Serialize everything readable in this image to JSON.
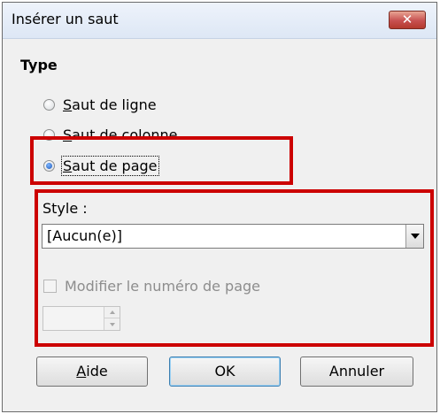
{
  "window": {
    "title": "Insérer un saut",
    "close_glyph": "✕"
  },
  "type_section": {
    "heading": "Type",
    "options": [
      {
        "label": "Saut de ligne",
        "selected": false
      },
      {
        "label": "Saut de colonne",
        "selected": false
      },
      {
        "label": "Saut de page",
        "selected": true
      }
    ]
  },
  "style_section": {
    "label": "Style :",
    "value": "[Aucun(e)]",
    "change_page_number_label": "Modifier le numéro de page",
    "change_page_number_checked": false,
    "page_number_value": ""
  },
  "buttons": {
    "help": "Aide",
    "ok": "OK",
    "cancel": "Annuler"
  },
  "icons": [
    "close-icon",
    "chevron-down-icon",
    "spin-up-icon",
    "spin-down-icon"
  ],
  "colors": {
    "highlight": "#cc0000",
    "title_bar": "#dde7f5",
    "dialog_bg": "#f0f0f0"
  }
}
